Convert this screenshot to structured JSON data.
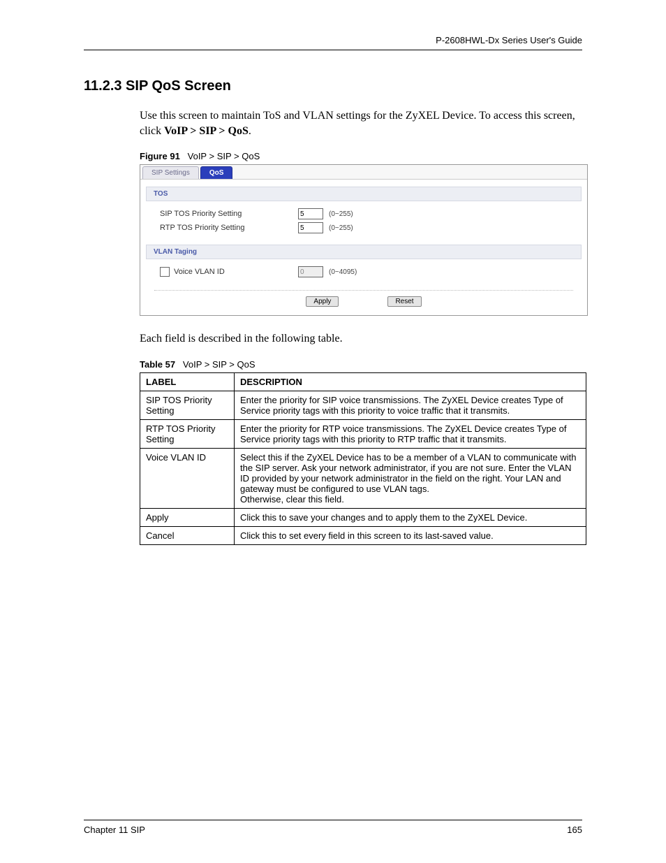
{
  "header": {
    "guide_title": "P-2608HWL-Dx Series User's Guide"
  },
  "section": {
    "number_title": "11.2.3  SIP QoS Screen",
    "intro_pre": "Use this screen to maintain ToS and VLAN settings for the ZyXEL Device. To access this screen, click ",
    "intro_bold": "VoIP > SIP > QoS",
    "intro_post": "."
  },
  "figure": {
    "label": "Figure 91",
    "caption": "VoIP > SIP > QoS",
    "tabs": {
      "inactive": "SIP Settings",
      "active": "QoS"
    },
    "tos": {
      "header": "TOS",
      "row1_label": "SIP TOS Priority Setting",
      "row1_value": "5",
      "row1_range": "(0~255)",
      "row2_label": "RTP TOS Priority Setting",
      "row2_value": "5",
      "row2_range": "(0~255)"
    },
    "vlan": {
      "header": "VLAN Taging",
      "row_label": "Voice VLAN ID",
      "row_value": "0",
      "row_range": "(0~4095)"
    },
    "buttons": {
      "apply": "Apply",
      "reset": "Reset"
    }
  },
  "between_text": "Each field is described in the following table.",
  "table": {
    "label": "Table 57",
    "caption": "VoIP > SIP > QoS",
    "head_label": "LABEL",
    "head_desc": "DESCRIPTION",
    "rows": [
      {
        "label": "SIP TOS Priority Setting",
        "desc": "Enter the priority for SIP voice transmissions. The ZyXEL Device creates Type of Service priority tags with this priority to voice traffic that it transmits."
      },
      {
        "label": "RTP TOS Priority Setting",
        "desc": "Enter the priority for RTP voice transmissions. The ZyXEL Device creates Type of Service priority tags with this priority to RTP traffic that it transmits."
      },
      {
        "label": "Voice VLAN ID",
        "desc": "Select this if the ZyXEL Device has to be a member of a VLAN to communicate with the SIP server. Ask your network administrator, if you are not sure. Enter the VLAN ID provided by your network administrator in the field on the right. Your LAN and gateway must be configured to use VLAN tags.\nOtherwise, clear this field."
      },
      {
        "label": "Apply",
        "desc": "Click this to save your changes and to apply them to the ZyXEL Device."
      },
      {
        "label": "Cancel",
        "desc": "Click this to set every field in this screen to its last-saved value."
      }
    ]
  },
  "footer": {
    "left": "Chapter 11 SIP",
    "right": "165"
  }
}
